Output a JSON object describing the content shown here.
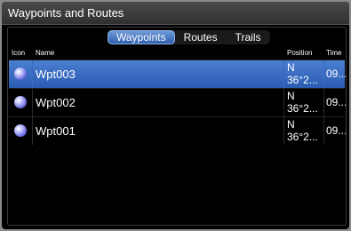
{
  "window": {
    "title": "Waypoints and Routes"
  },
  "tabs": [
    {
      "label": "Waypoints",
      "active": true
    },
    {
      "label": "Routes",
      "active": false
    },
    {
      "label": "Trails",
      "active": false
    }
  ],
  "columns": {
    "icon": "Icon",
    "name": "Name",
    "position": "Position",
    "time": "Time"
  },
  "rows": [
    {
      "icon": "waypoint-icon",
      "name": "Wpt003",
      "position_line1": "N",
      "position_line2": "36°2...",
      "time": "09...",
      "selected": true
    },
    {
      "icon": "waypoint-icon",
      "name": "Wpt002",
      "position_line1": "N",
      "position_line2": "36°2...",
      "time": "09...",
      "selected": false
    },
    {
      "icon": "waypoint-icon",
      "name": "Wpt001",
      "position_line1": "N",
      "position_line2": "36°2...",
      "time": "09...",
      "selected": false
    }
  ],
  "colors": {
    "selection": "#3a6cc4",
    "tab_active": "#3c6bbd"
  }
}
